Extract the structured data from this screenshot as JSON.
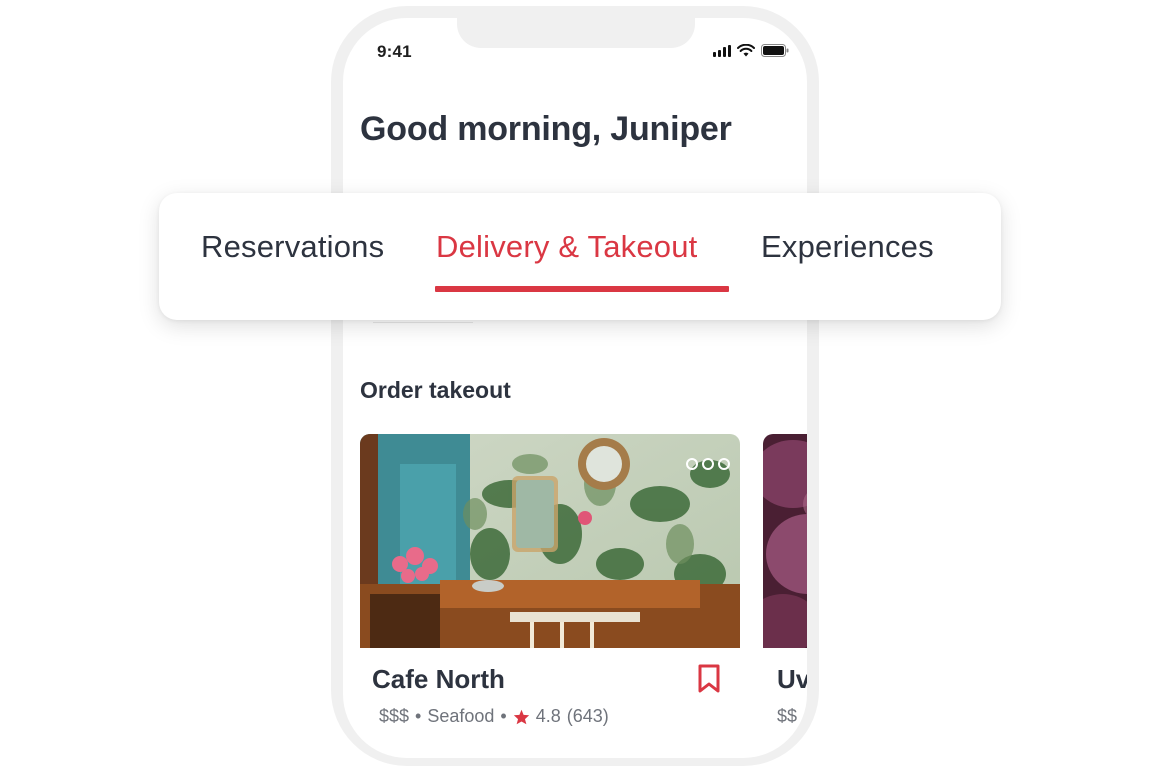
{
  "status_bar": {
    "time": "9:41"
  },
  "greeting": "Good morning, Juniper",
  "tabs": [
    {
      "label": "Reservations",
      "active": false
    },
    {
      "label": "Delivery & Takeout",
      "active": true
    },
    {
      "label": "Experiences",
      "active": false
    }
  ],
  "section_title": "Order takeout",
  "restaurants": [
    {
      "name": "Cafe North",
      "price": "$$$",
      "cuisine": "Seafood",
      "rating": "4.8",
      "reviews": "(643)"
    },
    {
      "name": "Uv",
      "price": "$$"
    }
  ],
  "colors": {
    "accent": "#da3743",
    "text": "#2d333f",
    "muted": "#6f737b"
  },
  "icons": [
    "signal-icon",
    "wifi-icon",
    "battery-icon",
    "more-icon",
    "bookmark-icon",
    "star-icon"
  ]
}
